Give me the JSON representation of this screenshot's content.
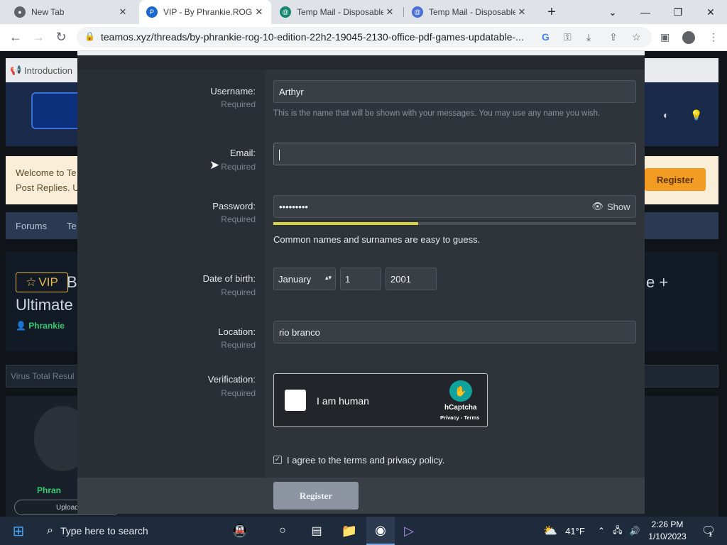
{
  "browser": {
    "tabs": [
      {
        "title": "New Tab",
        "icon": "chrome-icon"
      },
      {
        "title": "VIP - By Phrankie.ROG",
        "icon": "teamos-icon"
      },
      {
        "title": "Temp Mail - Disposable",
        "icon": "tempmail-icon"
      },
      {
        "title": "Temp Mail - Disposable",
        "icon": "at-icon"
      }
    ],
    "new_tab": "+",
    "url": "teamos.xyz/threads/by-phrankie-rog-10-edition-22h2-19045-2130-office-pdf-games-updatable-..."
  },
  "background": {
    "notice_start": "Introduction",
    "welcome_line1": "Welcome to Te",
    "welcome_line2": "Post Replies. U",
    "register": "Register",
    "breadcrumb_forums": "Forums",
    "breadcrumb_next": "Te",
    "vip_badge": "VIP",
    "title_fragment_1": "By",
    "title_fragment_2": "Ultimate",
    "title_fragment_right": "e +",
    "author": "Phrankie",
    "author2": "Phran",
    "virus_total": "Virus Total Resul",
    "upload": "Upload"
  },
  "form": {
    "username_label": "Username:",
    "username_required": "Required",
    "username_value": "Arthyr",
    "username_hint": "This is the name that will be shown with your messages. You may use any name you wish.",
    "email_label": "Email:",
    "email_required": "Required",
    "email_value": "",
    "password_label": "Password:",
    "password_required": "Required",
    "password_value": "•••••••••",
    "password_show": "Show",
    "password_strength": 0.4,
    "password_strength_color": "#d6d242",
    "password_hint": "Common names and surnames are easy to guess.",
    "dob_label": "Date of birth:",
    "dob_required": "Required",
    "dob_month": "January",
    "dob_day": "1",
    "dob_year": "2001",
    "location_label": "Location:",
    "location_required": "Required",
    "location_value": "rio branco",
    "verification_label": "Verification:",
    "verification_required": "Required",
    "captcha_text": "I am human",
    "captcha_brand": "hCaptcha",
    "captcha_links": "Privacy - Terms",
    "agree_text": "I agree to the terms and privacy policy.",
    "register_button": "Register"
  },
  "taskbar": {
    "search_placeholder": "Type here to search",
    "weather_temp": "41°F",
    "time": "2:26 PM",
    "date": "1/10/2023",
    "notification_count": "1"
  },
  "colors": {
    "accent": "#f39c24",
    "vip": "#e8b84a",
    "author_green": "#2ecc71"
  }
}
